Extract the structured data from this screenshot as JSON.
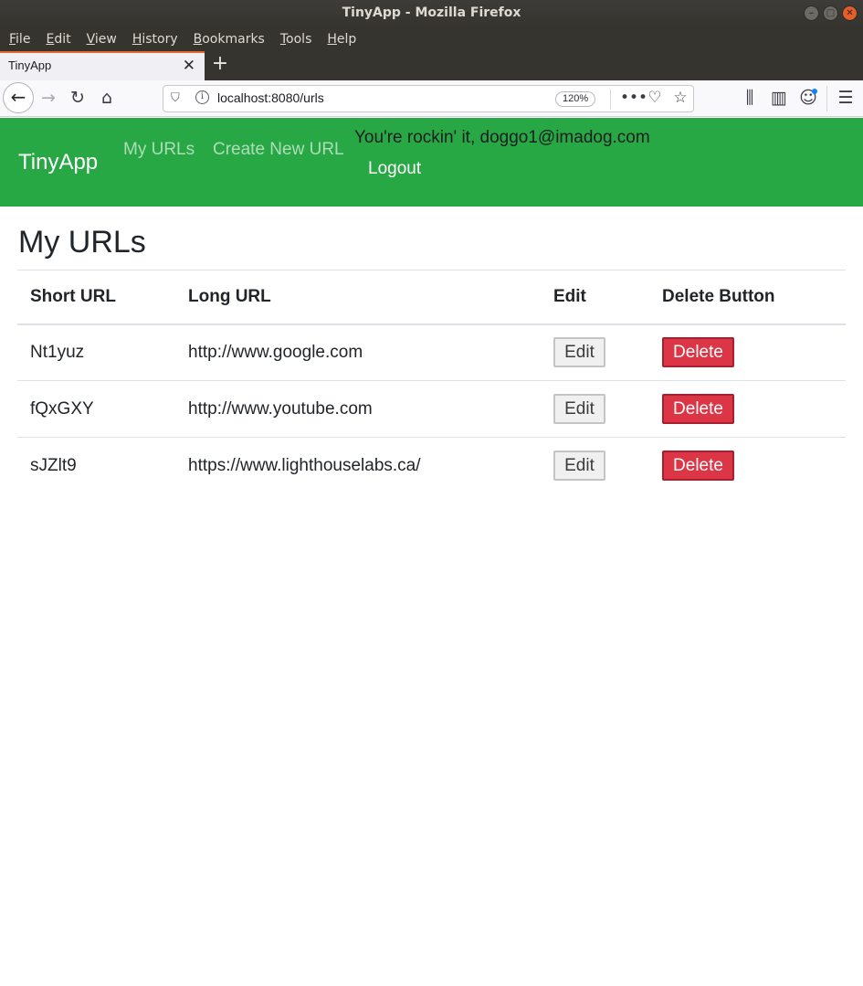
{
  "window": {
    "title": "TinyApp - Mozilla Firefox"
  },
  "menu": [
    "File",
    "Edit",
    "View",
    "History",
    "Bookmarks",
    "Tools",
    "Help"
  ],
  "tab": {
    "title": "TinyApp"
  },
  "urlbar": {
    "url": "localhost:8080/urls",
    "zoom": "120%"
  },
  "app": {
    "brand": "TinyApp",
    "nav": {
      "my_urls": "My URLs",
      "create": "Create New URL"
    },
    "greeting": "You're rockin' it, doggo1@imadog.com",
    "logout": "Logout"
  },
  "main": {
    "title": "My URLs",
    "headers": [
      "Short URL",
      "Long URL",
      "Edit",
      "Delete Button"
    ],
    "rows": [
      {
        "short": "Nt1yuz",
        "long": "http://www.google.com",
        "edit": "Edit",
        "delete": "Delete"
      },
      {
        "short": "fQxGXY",
        "long": "http://www.youtube.com",
        "edit": "Edit",
        "delete": "Delete"
      },
      {
        "short": "sJZlt9",
        "long": "https://www.lighthouselabs.ca/",
        "edit": "Edit",
        "delete": "Delete"
      }
    ]
  },
  "colors": {
    "navbar": "#28a745",
    "delete": "#dc3545",
    "tab_accent": "#e66633"
  }
}
